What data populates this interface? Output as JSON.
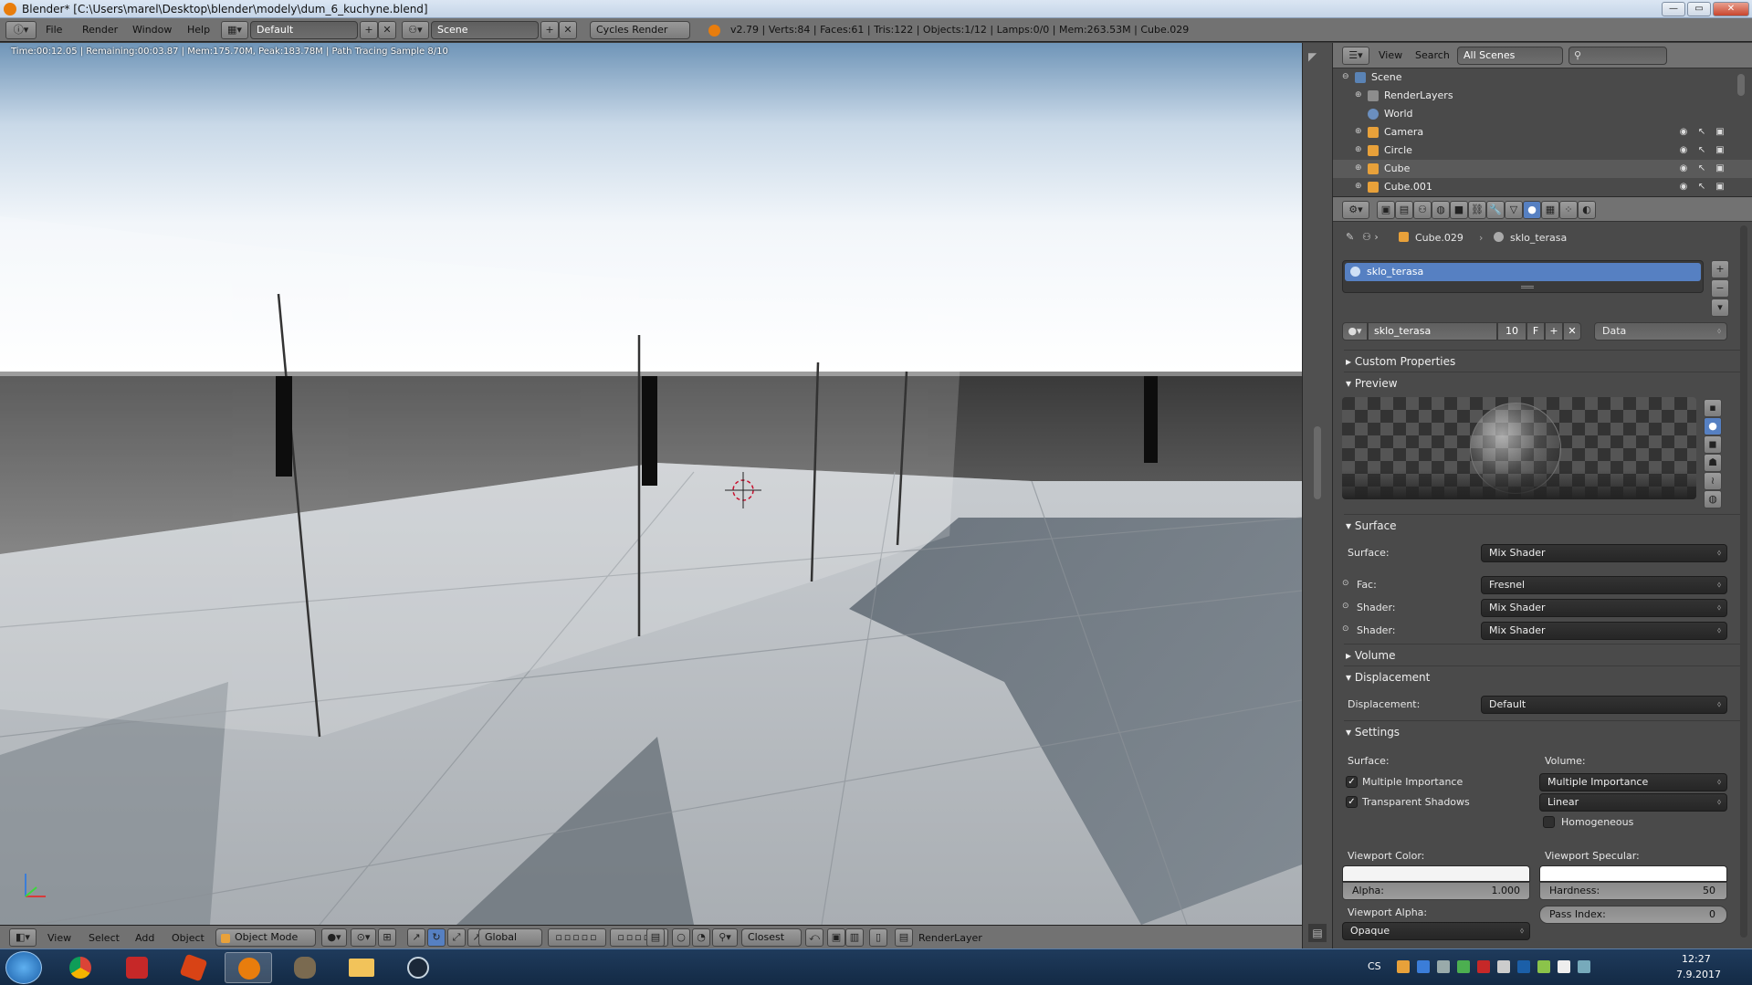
{
  "window": {
    "title": "Blender* [C:\\Users\\marel\\Desktop\\blender\\modely\\dum_6_kuchyne.blend]",
    "controls": {
      "minimize": "—",
      "maximize": "▭",
      "close": "✕"
    }
  },
  "info_header": {
    "menus": [
      "File",
      "Render",
      "Window",
      "Help"
    ],
    "screen_layout": "Default",
    "scene": "Scene",
    "render_engine": "Cycles Render",
    "stats": "v2.79 | Verts:84 | Faces:61 | Tris:122 | Objects:1/12 | Lamps:0/0 | Mem:263.53M | Cube.029"
  },
  "viewport": {
    "render_status": "Time:00:12.05 | Remaining:00:03.87 | Mem:175.70M, Peak:183.78M | Path Tracing Sample 8/10"
  },
  "viewport_header": {
    "menus": [
      "View",
      "Select",
      "Add",
      "Object"
    ],
    "mode": "Object Mode",
    "orientation": "Global",
    "snap_target": "Closest",
    "render_layer": "RenderLayer"
  },
  "outliner": {
    "header_menus": [
      "View",
      "Search"
    ],
    "display_mode": "All Scenes",
    "search_placeholder": "",
    "items": [
      {
        "name": "Scene",
        "indent": 0
      },
      {
        "name": "RenderLayers",
        "indent": 1
      },
      {
        "name": "World",
        "indent": 1
      },
      {
        "name": "Camera",
        "indent": 1
      },
      {
        "name": "Circle",
        "indent": 1
      },
      {
        "name": "Cube",
        "indent": 1
      },
      {
        "name": "Cube.001",
        "indent": 1
      }
    ]
  },
  "properties": {
    "breadcrumb": {
      "object": "Cube.029",
      "material": "sklo_terasa"
    },
    "slot_name": "sklo_terasa",
    "material_name": "sklo_terasa",
    "material_users": "10",
    "fake_user": "F",
    "link": "Data",
    "panels": {
      "custom_properties": "Custom Properties",
      "preview": "Preview",
      "surface": "Surface",
      "volume": "Volume",
      "displacement": "Displacement",
      "settings": "Settings"
    },
    "surface": {
      "surface_label": "Surface:",
      "surface_value": "Mix Shader",
      "fac_label": "Fac:",
      "fac_value": "Fresnel",
      "shader1_label": "Shader:",
      "shader1_value": "Mix Shader",
      "shader2_label": "Shader:",
      "shader2_value": "Mix Shader"
    },
    "displacement": {
      "label": "Displacement:",
      "value": "Default"
    },
    "settings": {
      "surface_label": "Surface:",
      "volume_label": "Volume:",
      "multiple_importance": "Multiple Importance",
      "transparent_shadows": "Transparent Shadows",
      "volume_sampling": "Multiple Importance",
      "volume_interpolation": "Linear",
      "homogeneous": "Homogeneous",
      "viewport_color_label": "Viewport Color:",
      "viewport_specular_label": "Viewport Specular:",
      "alpha_label": "Alpha:",
      "alpha_value": "1.000",
      "hardness_label": "Hardness:",
      "hardness_value": "50",
      "viewport_alpha_label": "Viewport Alpha:",
      "viewport_alpha_value": "Opaque",
      "pass_index_label": "Pass Index:",
      "pass_index_value": "0"
    }
  },
  "taskbar": {
    "language": "CS",
    "time": "12:27",
    "date": "7.9.2017"
  },
  "colors": {
    "accent_blue": "#5680c2",
    "blender_orange": "#e87d0d",
    "panel_bg": "#4a4a4a",
    "header_bg": "#727272"
  }
}
